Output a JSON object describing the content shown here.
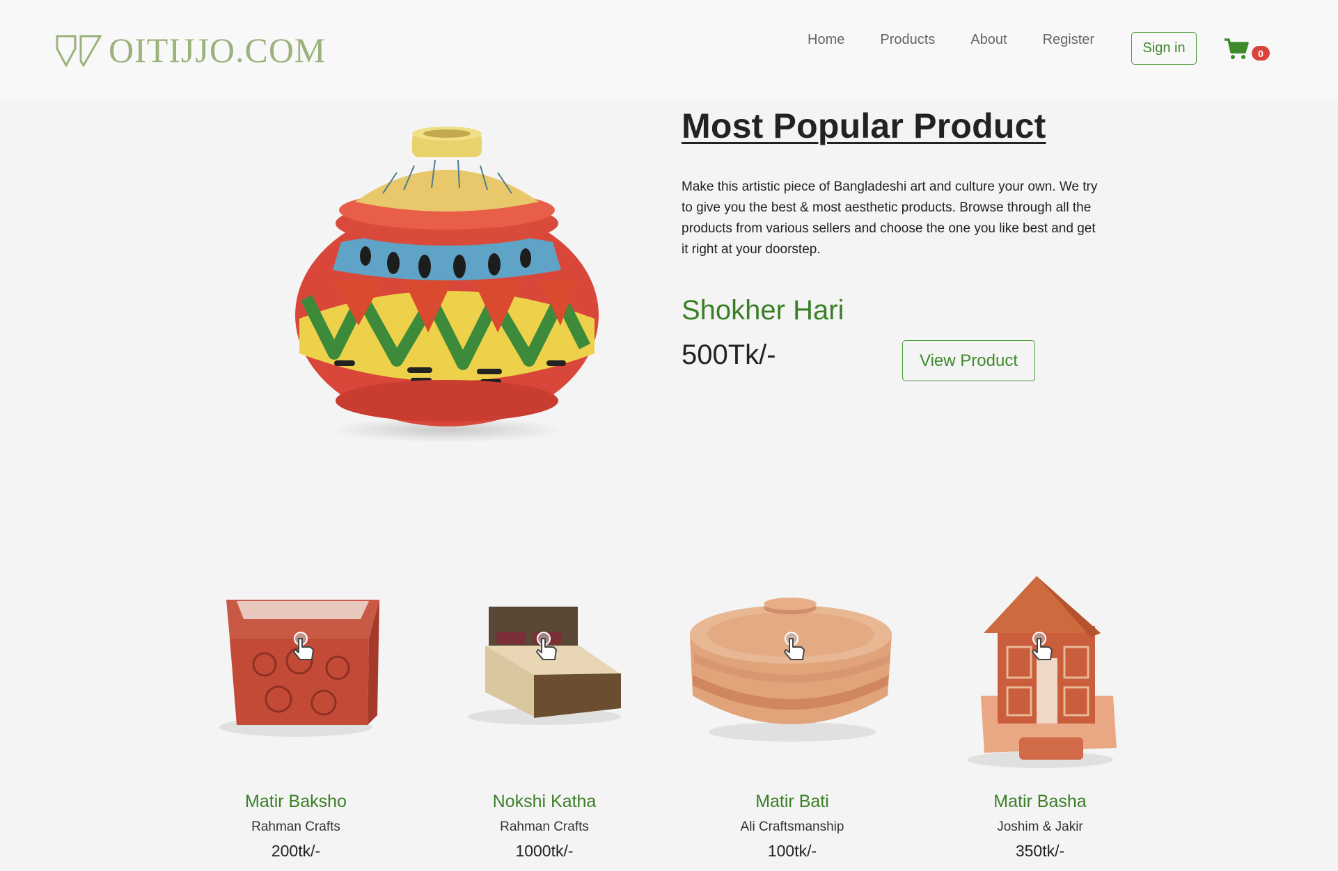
{
  "brand": {
    "name": "OITIJJO.COM",
    "color": "#9bb27c"
  },
  "nav": {
    "links": [
      "Home",
      "Products",
      "About",
      "Register"
    ],
    "signin_label": "Sign in",
    "cart_count": "0"
  },
  "hero": {
    "title": "Most Popular Product",
    "description": "Make this artistic piece of Bangladeshi art and culture your own. We try to give you the best & most aesthetic products. Browse through all the products from various sellers and choose the one you like best and get it right at your doorstep.",
    "product_name": "Shokher Hari",
    "price": "500Tk/-",
    "view_label": "View Product"
  },
  "products": [
    {
      "name": "Matir Baksho",
      "seller": "Rahman Crafts",
      "price": "200tk/-"
    },
    {
      "name": "Nokshi Katha",
      "seller": "Rahman Crafts",
      "price": "1000tk/-"
    },
    {
      "name": "Matir Bati",
      "seller": "Ali Craftsmanship",
      "price": "100tk/-"
    },
    {
      "name": "Matir Basha",
      "seller": "Joshim & Jakir",
      "price": "350tk/-"
    }
  ],
  "colors": {
    "accent": "#3a7f26",
    "button_border": "#4a9a38",
    "badge": "#d9433a",
    "background": "#f4f4f4"
  }
}
